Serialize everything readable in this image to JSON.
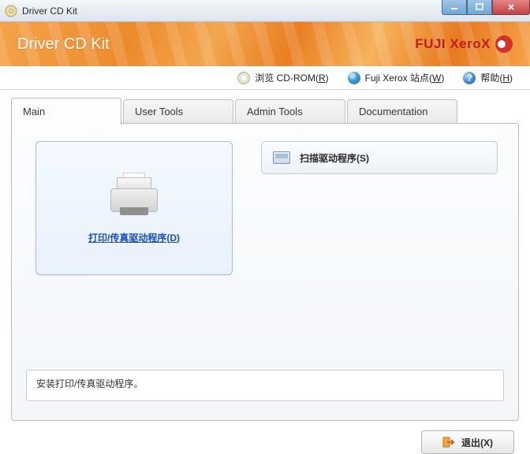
{
  "window": {
    "title": "Driver CD Kit"
  },
  "banner": {
    "title": "Driver CD Kit",
    "brand": "FUJI XeroX"
  },
  "toolbar": {
    "browse_cd": "浏览 CD-ROM",
    "browse_cd_hot": "R",
    "site": "Fuji Xerox 站点",
    "site_hot": "W",
    "help": "帮助",
    "help_hot": "H"
  },
  "tabs": {
    "main": "Main",
    "user_tools": "User Tools",
    "admin_tools": "Admin Tools",
    "documentation": "Documentation"
  },
  "main_panel": {
    "print_fax": "打印/传真驱动程序",
    "print_fax_hot": "D",
    "scan": "扫描驱动程序",
    "scan_hot": "S",
    "description": "安装打印/传真驱动程序。"
  },
  "footer": {
    "exit": "退出",
    "exit_hot": "X"
  }
}
